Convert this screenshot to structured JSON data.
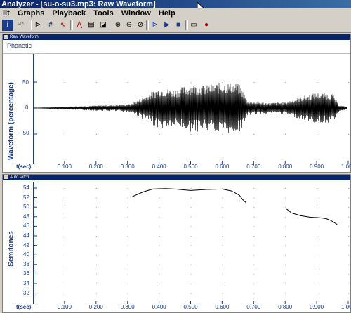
{
  "window": {
    "title": "Analyzer - [su-o-su3.mp3: Raw Waveform]"
  },
  "menu": [
    "lit",
    "Graphs",
    "Playback",
    "Tools",
    "Window",
    "Help"
  ],
  "waveform_pane": {
    "header": "Raw Waveform",
    "phonetic_label": "Phonetic",
    "y_axis_title": "Waveform (percentage)",
    "y_ticks": [
      "50",
      "0",
      "-50"
    ],
    "x_label": "t(sec)",
    "x_ticks": [
      "0.100",
      "0.200",
      "0.300",
      "0.400",
      "0.500",
      "0.600",
      "0.700",
      "0.800",
      "0.900",
      "1.000"
    ]
  },
  "pitch_pane": {
    "header": "Auto Pitch",
    "y_axis_title": "Semitones",
    "y_ticks": [
      "54",
      "52",
      "50",
      "48",
      "46",
      "44",
      "42",
      "40",
      "38",
      "36",
      "34",
      "32"
    ],
    "x_label": "t(sec)",
    "x_ticks": [
      "0.100",
      "0.200",
      "0.300",
      "0.400",
      "0.500",
      "0.600",
      "0.700",
      "0.800",
      "0.900",
      "1.000"
    ]
  },
  "chart_data": [
    {
      "type": "line",
      "ylabel": "Waveform (percentage)",
      "xlabel": "t(sec)",
      "xlim": [
        0.0,
        1.0
      ],
      "ylim": [
        -100,
        100
      ],
      "envelope": {
        "t": [
          0.0,
          0.08,
          0.15,
          0.25,
          0.31,
          0.35,
          0.4,
          0.45,
          0.5,
          0.55,
          0.6,
          0.65,
          0.66,
          0.68,
          0.72,
          0.75,
          0.8,
          0.85,
          0.9,
          0.95,
          0.97,
          1.0
        ],
        "amp": [
          0,
          2,
          4,
          6,
          8,
          22,
          40,
          36,
          46,
          44,
          50,
          48,
          42,
          14,
          12,
          10,
          12,
          22,
          30,
          28,
          6,
          2
        ]
      }
    },
    {
      "type": "line",
      "ylabel": "Semitones",
      "xlabel": "t(sec)",
      "xlim": [
        0.0,
        1.0
      ],
      "ylim": [
        31,
        55
      ],
      "series": [
        {
          "x": [
            0.315,
            0.35,
            0.38,
            0.42,
            0.45,
            0.5,
            0.55,
            0.6,
            0.63,
            0.655,
            0.665,
            0.675
          ],
          "y": [
            52.2,
            53.2,
            53.8,
            53.9,
            53.8,
            53.5,
            53.7,
            53.8,
            53.4,
            52.5,
            51.6,
            51.0
          ]
        },
        {
          "x": [
            0.805,
            0.82,
            0.85,
            0.88,
            0.91,
            0.93,
            0.945,
            0.955,
            0.965
          ],
          "y": [
            49.6,
            48.8,
            48.2,
            47.9,
            47.8,
            47.6,
            47.2,
            46.8,
            46.4
          ]
        }
      ]
    }
  ]
}
